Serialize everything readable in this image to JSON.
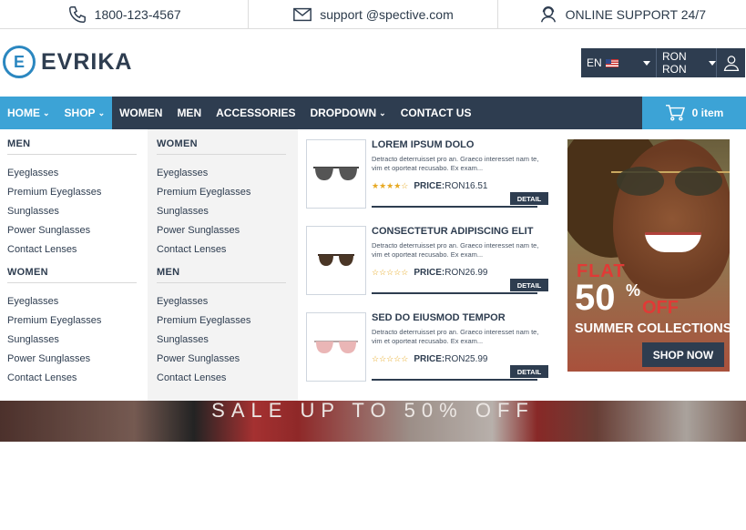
{
  "topbar": {
    "phone": "1800-123-4567",
    "email": "support @spective.com",
    "support": "ONLINE SUPPORT 24/7"
  },
  "header": {
    "logo_letter": "E",
    "logo_text": "EVRIKA",
    "language": "EN",
    "currency": "RON RON"
  },
  "nav": {
    "items": [
      "HOME",
      "SHOP",
      "WOMEN",
      "MEN",
      "ACCESSORIES",
      "DROPDOWN",
      "CONTACT US"
    ],
    "cart": "0 item"
  },
  "mega": {
    "col1": {
      "group1": {
        "title": "MEN",
        "links": [
          "Eyeglasses",
          "Premium Eyeglasses",
          "Sunglasses",
          "Power Sunglasses",
          "Contact Lenses"
        ]
      },
      "group2": {
        "title": "WOMEN",
        "links": [
          "Eyeglasses",
          "Premium Eyeglasses",
          "Sunglasses",
          "Power Sunglasses",
          "Contact Lenses"
        ]
      }
    },
    "col2": {
      "group1": {
        "title": "WOMEN",
        "links": [
          "Eyeglasses",
          "Premium Eyeglasses",
          "Sunglasses",
          "Power Sunglasses",
          "Contact Lenses"
        ]
      },
      "group2": {
        "title": "MEN",
        "links": [
          "Eyeglasses",
          "Premium Eyeglasses",
          "Sunglasses",
          "Power Sunglasses",
          "Contact Lenses"
        ]
      }
    },
    "products": [
      {
        "title": "LOREM IPSUM DOLO",
        "desc": "Detracto deterruisset pro an. Graeco interesset nam te, vim et oporteat recusabo. Ex exam...",
        "price_label": "PRICE:",
        "price": "RON16.51",
        "stars": "★★★★☆",
        "detail": "DETAIL"
      },
      {
        "title": "CONSECTETUR ADIPISCING ELIT",
        "desc": "Detracto deterruisset pro an. Graeco interesset nam te, vim et oporteat recusabo. Ex exam...",
        "price_label": "PRICE:",
        "price": "RON26.99",
        "stars": "☆☆☆☆☆",
        "detail": "DETAIL"
      },
      {
        "title": "SED DO EIUSMOD TEMPOR",
        "desc": "Detracto deterruisset pro an. Graeco interesset nam te, vim et oporteat recusabo. Ex exam...",
        "price_label": "PRICE:",
        "price": "RON25.99",
        "stars": "☆☆☆☆☆",
        "detail": "DETAIL"
      }
    ],
    "promo": {
      "flat": "FLAT",
      "fifty": "50",
      "pct": "%",
      "off": "OFF",
      "summer": "SUMMER COLLECTIONS",
      "shop": "SHOP NOW"
    }
  },
  "hero": {
    "text": "SALE UP TO 50% OFF"
  },
  "colors": {
    "navy": "#2e3d50",
    "blue": "#3ca3d6",
    "red": "#e03a36",
    "gold": "#e7a923"
  }
}
